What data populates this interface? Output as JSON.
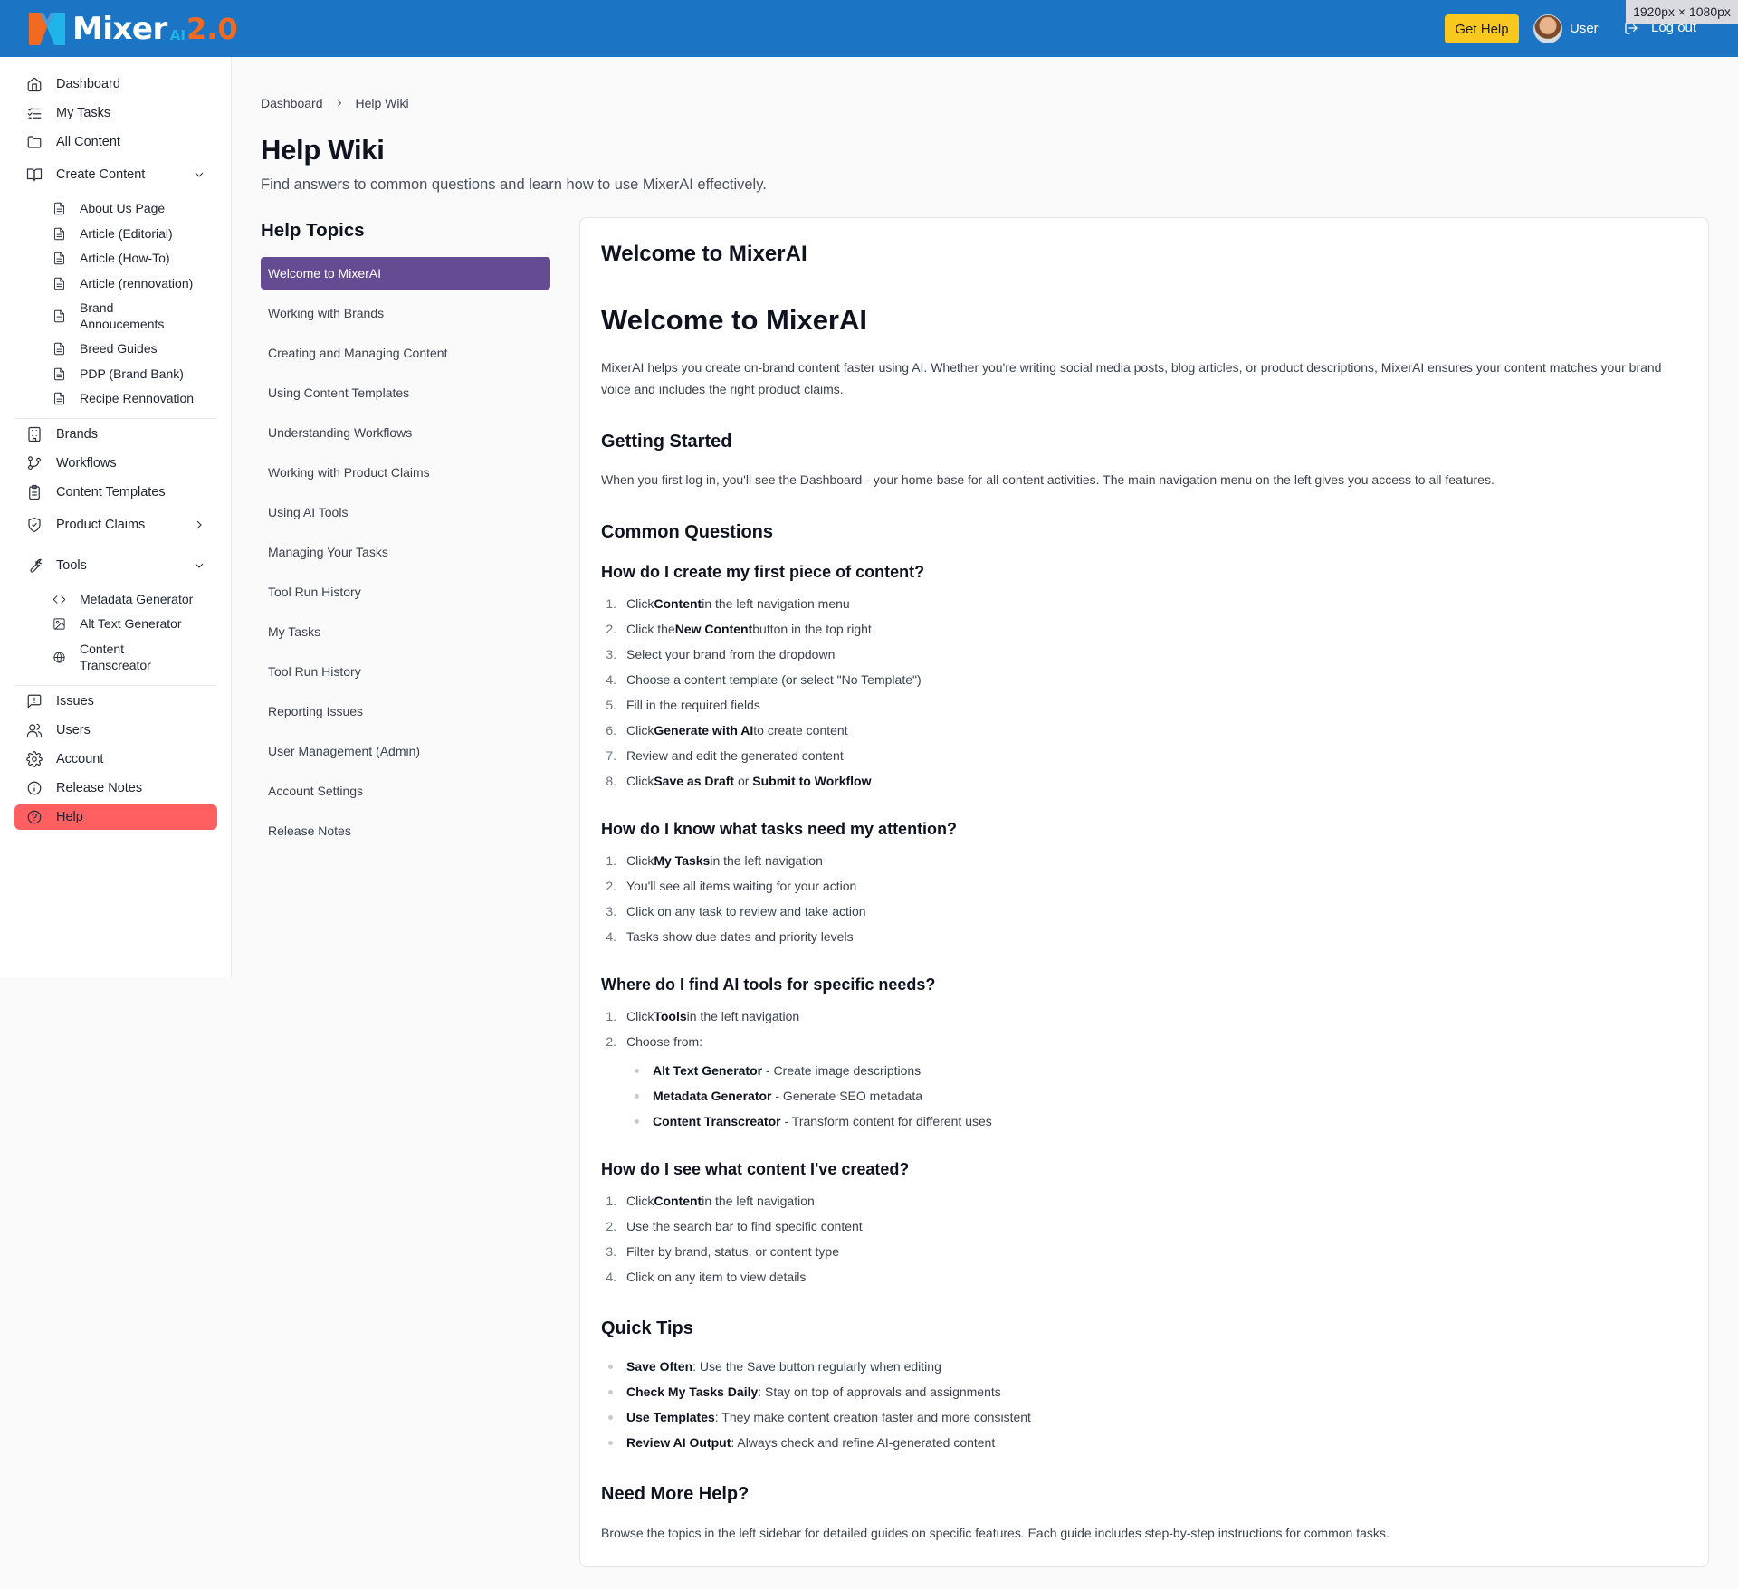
{
  "header": {
    "logo_text": "Mixer",
    "logo_ai": "AI",
    "logo_version": "2.0",
    "help_button": "Get Help",
    "user_name": "User",
    "logout": "Log out",
    "dimensions_badge": "1920px × 1080px",
    "colors": {
      "bar": "#1b75c4",
      "help_button": "#fac81e",
      "logo_version": "#f26a21"
    }
  },
  "sidebar": {
    "items": [
      {
        "label": "Dashboard",
        "icon": "home-icon"
      },
      {
        "label": "My Tasks",
        "icon": "list-checks-icon"
      },
      {
        "label": "All Content",
        "icon": "folder-icon"
      },
      {
        "label": "Create Content",
        "icon": "book-open-icon",
        "expanded": true
      },
      {
        "label": "Brands",
        "icon": "building-icon"
      },
      {
        "label": "Workflows",
        "icon": "git-branch-icon"
      },
      {
        "label": "Content Templates",
        "icon": "clipboard-icon"
      },
      {
        "label": "Product Claims",
        "icon": "shield-check-icon",
        "expanded": false
      },
      {
        "label": "Tools",
        "icon": "wrench-icon",
        "expanded": true
      },
      {
        "label": "Issues",
        "icon": "message-alert-icon"
      },
      {
        "label": "Users",
        "icon": "users-icon"
      },
      {
        "label": "Account",
        "icon": "gear-icon"
      },
      {
        "label": "Release Notes",
        "icon": "info-icon"
      },
      {
        "label": "Help",
        "icon": "help-circle-icon",
        "active": true
      }
    ],
    "create_content_items": [
      "About Us Page",
      "Article (Editorial)",
      "Article (How-To)",
      "Article (rennovation)",
      "Brand Annoucements",
      "Breed Guides",
      "PDP (Brand Bank)",
      "Recipe Rennovation"
    ],
    "tools_items": [
      {
        "label": "Metadata Generator",
        "icon": "code-icon"
      },
      {
        "label": "Alt Text Generator",
        "icon": "image-icon"
      },
      {
        "label": "Content Transcreator",
        "icon": "globe-icon"
      }
    ],
    "active_color": "#ff5f61"
  },
  "breadcrumb": [
    "Dashboard",
    "Help Wiki"
  ],
  "page": {
    "title": "Help Wiki",
    "subtitle": "Find answers to common questions and learn how to use MixerAI effectively."
  },
  "topics": {
    "title": "Help Topics",
    "active_color": "#654b91",
    "items": [
      "Welcome to MixerAI",
      "Working with Brands",
      "Creating and Managing Content",
      "Using Content Templates",
      "Understanding Workflows",
      "Working with Product Claims",
      "Using AI Tools",
      "Managing Your Tasks",
      "Tool Run History",
      "My Tasks",
      "Tool Run History",
      "Reporting Issues",
      "User Management (Admin)",
      "Account Settings",
      "Release Notes"
    ]
  },
  "article": {
    "card_title": "Welcome to MixerAI",
    "h1": "Welcome to MixerAI",
    "intro": "MixerAI helps you create on-brand content faster using AI. Whether you're writing social media posts, blog articles, or product descriptions, MixerAI ensures your content matches your brand voice and includes the right product claims.",
    "getting_started": {
      "heading": "Getting Started",
      "text": "When you first log in, you'll see the Dashboard - your home base for all content activities. The main navigation menu on the left gives you access to all features."
    },
    "common_questions": {
      "heading": "Common Questions",
      "q1": {
        "heading": "How do I create my first piece of content?",
        "steps": [
          {
            "pre": "Click ",
            "bold": "Content",
            "post": " in the left navigation menu"
          },
          {
            "pre": "Click the ",
            "bold": "New Content",
            "post": " button in the top right"
          },
          {
            "pre": "Select your brand from the dropdown",
            "bold": "",
            "post": ""
          },
          {
            "pre": "Choose a content template (or select \"No Template\")",
            "bold": "",
            "post": ""
          },
          {
            "pre": "Fill in the required fields",
            "bold": "",
            "post": ""
          },
          {
            "pre": "Click ",
            "bold": "Generate with AI",
            "post": " to create content"
          },
          {
            "pre": "Review and edit the generated content",
            "bold": "",
            "post": ""
          },
          {
            "pre": "Click ",
            "bold": "Save as Draft",
            "mid": " or ",
            "bold2": "Submit to Workflow",
            "post": ""
          }
        ]
      },
      "q2": {
        "heading": "How do I know what tasks need my attention?",
        "steps": [
          {
            "pre": "Click ",
            "bold": "My Tasks",
            "post": " in the left navigation"
          },
          {
            "pre": "You'll see all items waiting for your action",
            "bold": "",
            "post": ""
          },
          {
            "pre": "Click on any task to review and take action",
            "bold": "",
            "post": ""
          },
          {
            "pre": "Tasks show due dates and priority levels",
            "bold": "",
            "post": ""
          }
        ]
      },
      "q3": {
        "heading": "Where do I find AI tools for specific needs?",
        "steps": [
          {
            "pre": "Click ",
            "bold": "Tools",
            "post": " in the left navigation"
          },
          {
            "pre": "Choose from:",
            "bold": "",
            "post": ""
          }
        ],
        "tools": [
          {
            "bold": "Alt Text Generator",
            "post": " - Create image descriptions"
          },
          {
            "bold": "Metadata Generator",
            "post": " - Generate SEO metadata"
          },
          {
            "bold": "Content Transcreator",
            "post": " - Transform content for different uses"
          }
        ]
      },
      "q4": {
        "heading": "How do I see what content I've created?",
        "steps": [
          {
            "pre": "Click ",
            "bold": "Content",
            "post": " in the left navigation"
          },
          {
            "pre": "Use the search bar to find specific content",
            "bold": "",
            "post": ""
          },
          {
            "pre": "Filter by brand, status, or content type",
            "bold": "",
            "post": ""
          },
          {
            "pre": "Click on any item to view details",
            "bold": "",
            "post": ""
          }
        ]
      }
    },
    "quick_tips": {
      "heading": "Quick Tips",
      "items": [
        {
          "bold": "Save Often",
          "post": ": Use the Save button regularly when editing"
        },
        {
          "bold": "Check My Tasks Daily",
          "post": ": Stay on top of approvals and assignments"
        },
        {
          "bold": "Use Templates",
          "post": ": They make content creation faster and more consistent"
        },
        {
          "bold": "Review AI Output",
          "post": ": Always check and refine AI-generated content"
        }
      ]
    },
    "more_help": {
      "heading": "Need More Help?",
      "text": "Browse the topics in the left sidebar for detailed guides on specific features. Each guide includes step-by-step instructions for common tasks."
    }
  }
}
